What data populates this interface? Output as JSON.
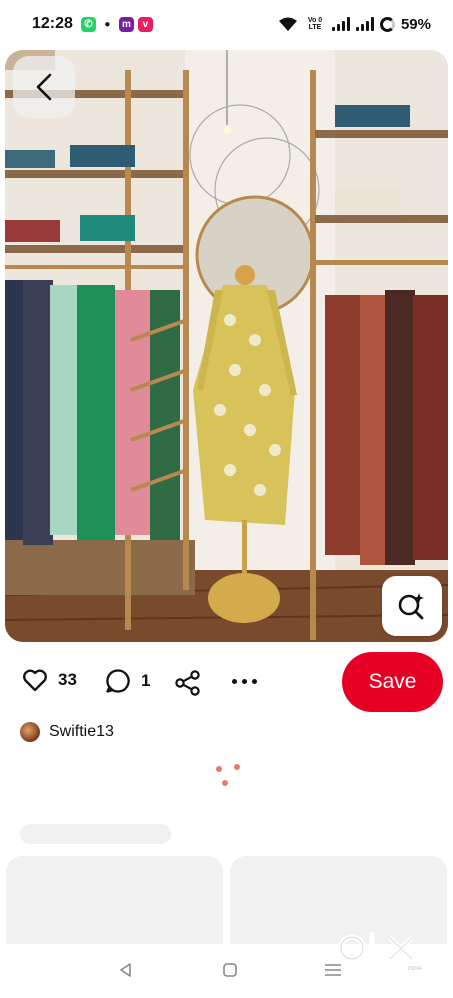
{
  "status_bar": {
    "time": "12:28",
    "network": "Vo 0 LTE",
    "battery": "59%"
  },
  "pin": {
    "image_alt": "Clothing store interior with mannequin wearing yellow printed kurta",
    "back_icon": "chevron-left-icon",
    "lens_icon": "visual-search-icon"
  },
  "actions": {
    "likes": "33",
    "comments": "1",
    "save_label": "Save",
    "colors": {
      "save": "#e60023",
      "text": "#111111"
    }
  },
  "creator": {
    "name": "Swiftie13"
  },
  "watermark": "olx",
  "watermark_sub": "INDIA"
}
